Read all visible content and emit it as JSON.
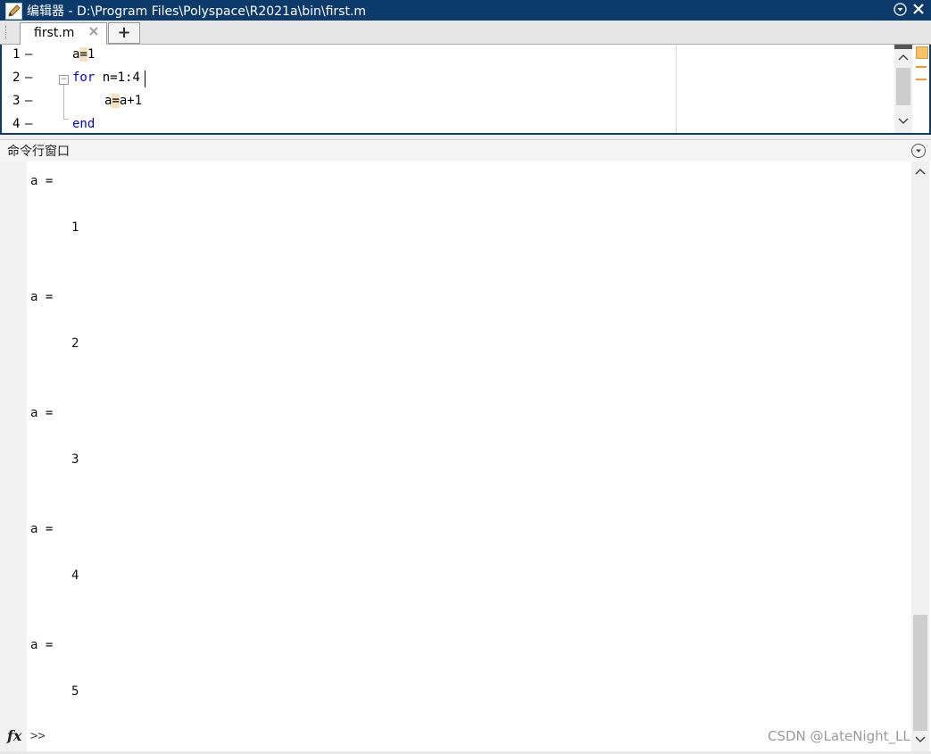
{
  "titlebar": {
    "title": "编辑器 - D:\\Program Files\\Polyspace\\R2021a\\bin\\first.m",
    "menu_icon": "circle-chevron-down-icon",
    "close_icon": "close-icon"
  },
  "tabs": [
    {
      "label": "first.m",
      "active": true
    }
  ],
  "tab_add_label": "+",
  "editor": {
    "lines": [
      {
        "number": "1",
        "marker": "—"
      },
      {
        "number": "2",
        "marker": "—"
      },
      {
        "number": "3",
        "marker": "—"
      },
      {
        "number": "4",
        "marker": "—"
      }
    ],
    "code": {
      "line1_a": "a",
      "line1_eq": "=",
      "line1_rest": "1",
      "line2_kw": "for",
      "line2_rest": " n=1:4",
      "line3_a": "a",
      "line3_eq": "=",
      "line3_rest": "a+1",
      "line4_kw": "end"
    },
    "fold_symbol": "−"
  },
  "command_window": {
    "title": "命令行窗口",
    "outputs": [
      {
        "label": "a =",
        "value": "1"
      },
      {
        "label": "a =",
        "value": "2"
      },
      {
        "label": "a =",
        "value": "3"
      },
      {
        "label": "a =",
        "value": "4"
      },
      {
        "label": "a =",
        "value": "5"
      }
    ],
    "prompt_fx": "fx",
    "prompt": ">>"
  },
  "watermark": "CSDN @LateNight_LL",
  "colors": {
    "titlebar": "#0c3a6b",
    "keyword": "#0000ff",
    "highlight": "#f5e2b8"
  }
}
